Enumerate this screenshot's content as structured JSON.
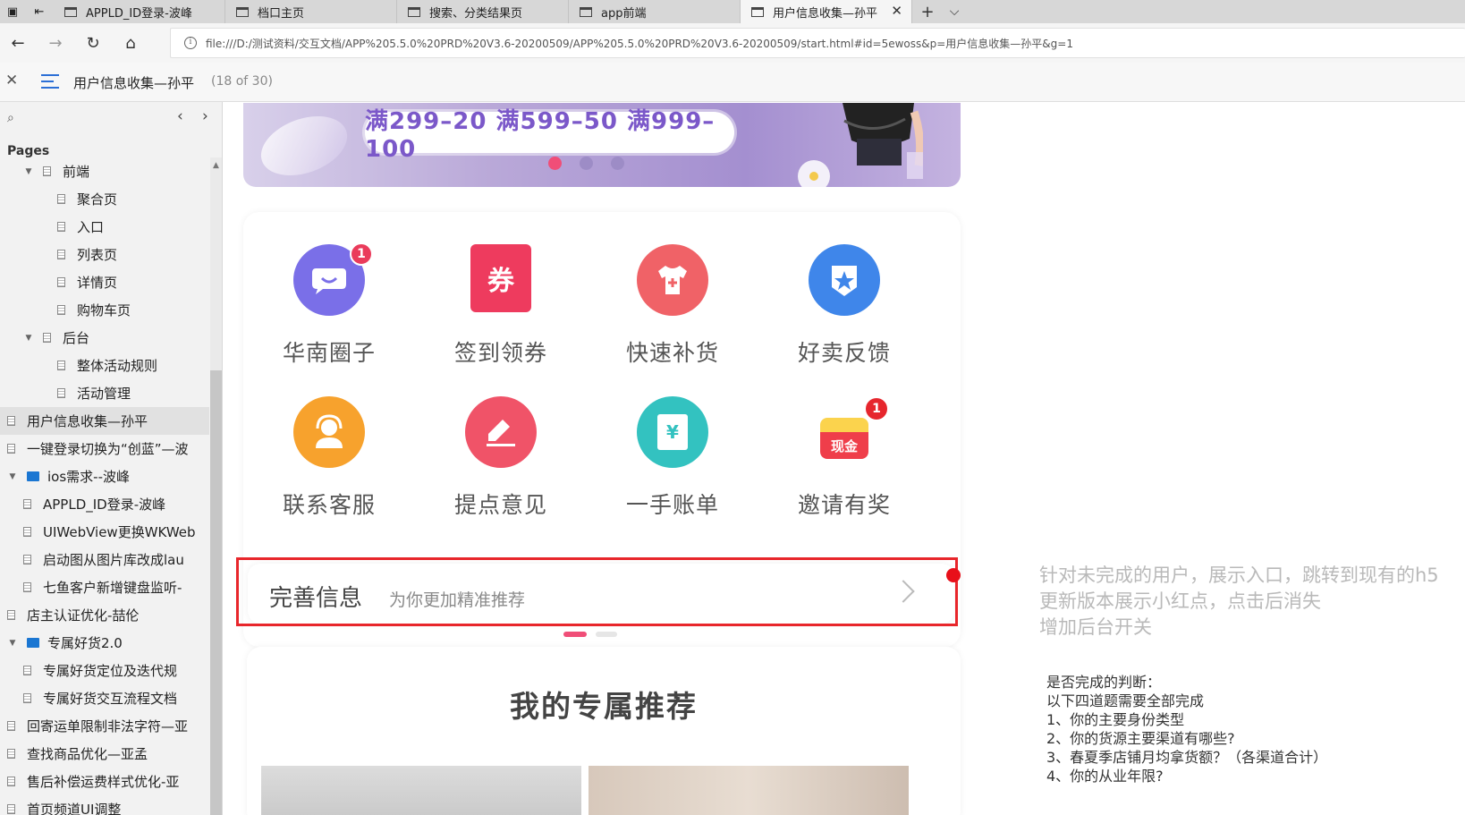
{
  "browser": {
    "tabs": [
      {
        "label": "APPLD_ID登录-波峰",
        "active": false
      },
      {
        "label": "档口主页",
        "active": false
      },
      {
        "label": "搜索、分类结果页",
        "active": false
      },
      {
        "label": "app前端",
        "active": false
      },
      {
        "label": "用户信息收集—孙平",
        "active": true
      }
    ],
    "tab_close": "✕",
    "new_tab": "+",
    "tab_menu": "⌵",
    "url": "file:///D:/测试资料/交互文档/APP%205.5.0%20PRD%20V3.6-20200509/APP%205.5.0%20PRD%20V3.6-20200509/start.html#id=5ewoss&p=用户信息收集—孙平&g=1"
  },
  "header": {
    "title": "用户信息收集—孙平",
    "count": "(18 of 30)"
  },
  "sidebar": {
    "pages_label": "Pages",
    "items": [
      {
        "label": "前端",
        "level": 1,
        "type": "page",
        "expanded": true
      },
      {
        "label": "聚合页",
        "level": 2,
        "type": "page"
      },
      {
        "label": "入口",
        "level": 2,
        "type": "page"
      },
      {
        "label": "列表页",
        "level": 2,
        "type": "page"
      },
      {
        "label": "详情页",
        "level": 2,
        "type": "page"
      },
      {
        "label": "购物车页",
        "level": 2,
        "type": "page"
      },
      {
        "label": "后台",
        "level": 1,
        "type": "page",
        "expanded": true
      },
      {
        "label": "整体活动规则",
        "level": 2,
        "type": "page"
      },
      {
        "label": "活动管理",
        "level": 2,
        "type": "page"
      },
      {
        "label": "用户信息收集—孙平",
        "level": 0,
        "type": "page",
        "selected": true
      },
      {
        "label": "一键登录切换为“创蓝”—波",
        "level": 0,
        "type": "page"
      },
      {
        "label": "ios需求--波峰",
        "level": 0,
        "type": "folder",
        "expanded": true
      },
      {
        "label": "APPLD_ID登录-波峰",
        "level": 1,
        "type": "page"
      },
      {
        "label": "UIWebView更换WKWeb",
        "level": 1,
        "type": "page"
      },
      {
        "label": "启动图从图片库改成lau",
        "level": 1,
        "type": "page"
      },
      {
        "label": "七鱼客户新增键盘监听-",
        "level": 1,
        "type": "page"
      },
      {
        "label": "店主认证优化-喆伦",
        "level": 0,
        "type": "page"
      },
      {
        "label": "专属好货2.0",
        "level": 0,
        "type": "folder",
        "expanded": true
      },
      {
        "label": "专属好货定位及迭代规",
        "level": 1,
        "type": "page"
      },
      {
        "label": "专属好货交互流程文档",
        "level": 1,
        "type": "page"
      },
      {
        "label": "回寄运单限制非法字符—亚",
        "level": 0,
        "type": "page"
      },
      {
        "label": "查找商品优化—亚孟",
        "level": 0,
        "type": "page"
      },
      {
        "label": "售后补偿运费样式优化-亚",
        "level": 0,
        "type": "page"
      },
      {
        "label": "首页频道UI调整",
        "level": 0,
        "type": "page"
      }
    ]
  },
  "mockup": {
    "banner_text": "满299–20 满599–50 满999–100",
    "grid": [
      {
        "label": "华南圈子",
        "icon": "chat-icon",
        "color": "#7a6fe8",
        "badge": "1"
      },
      {
        "label": "签到领券",
        "icon": "coupon-icon",
        "color": "#ee3b5e",
        "glyph": "券"
      },
      {
        "label": "快速补货",
        "icon": "tshirt-icon",
        "color": "#f06267"
      },
      {
        "label": "好卖反馈",
        "icon": "star-badge-icon",
        "color": "#3f86ea"
      },
      {
        "label": "联系客服",
        "icon": "headset-icon",
        "color": "#f7a22d"
      },
      {
        "label": "提点意见",
        "icon": "edit-icon",
        "color": "#f05368"
      },
      {
        "label": "一手账单",
        "icon": "receipt-icon",
        "color": "#33c2c0",
        "glyph": "¥"
      },
      {
        "label": "邀请有奖",
        "icon": "cash-icon",
        "color": "#f23c48",
        "glyph": "现金",
        "badge": "1"
      }
    ],
    "info_title": "完善信息",
    "info_sub": "为你更加精准推荐",
    "rec_title": "我的专属推荐"
  },
  "notes": {
    "gray": [
      "针对未完成的用户，展示入口，跳转到现有的h5",
      "更新版本展示小红点，点击后消失",
      "增加后台开关"
    ],
    "black": [
      "是否完成的判断：",
      "以下四道题需要全部完成",
      "1、你的主要身份类型",
      "2、你的货源主要渠道有哪些?",
      "3、春夏季店铺月均拿货额？（各渠道合计）",
      "4、你的从业年限?"
    ]
  }
}
